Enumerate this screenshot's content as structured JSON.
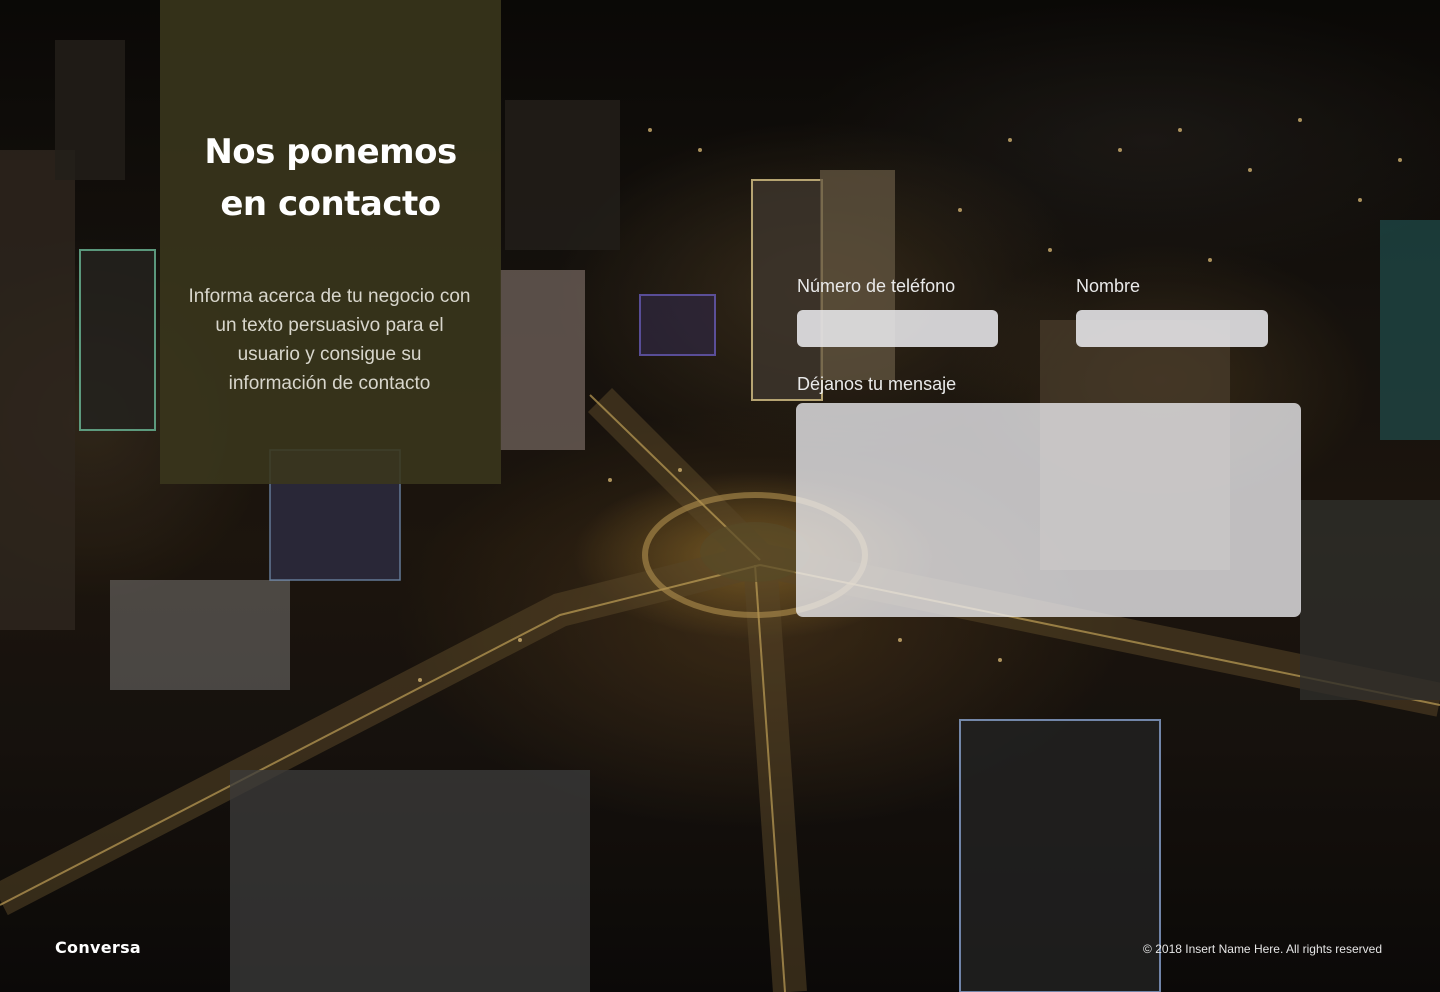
{
  "hero": {
    "title": "Nos ponemos en contacto",
    "description": "Informa acerca de tu negocio con un texto persuasivo para el usuario y consigue su información de contacto"
  },
  "form": {
    "phone_label": "Número de teléfono",
    "phone_value": "",
    "name_label": "Nombre",
    "name_value": "",
    "message_label": "Déjanos tu mensaje",
    "message_value": ""
  },
  "footer": {
    "brand": "Conversa",
    "copyright": "© 2018 Insert Name Here. All rights reserved"
  },
  "colors": {
    "panel": "#3a371c",
    "input_bg": "#e8e8ec",
    "text_light": "#ffffff"
  }
}
